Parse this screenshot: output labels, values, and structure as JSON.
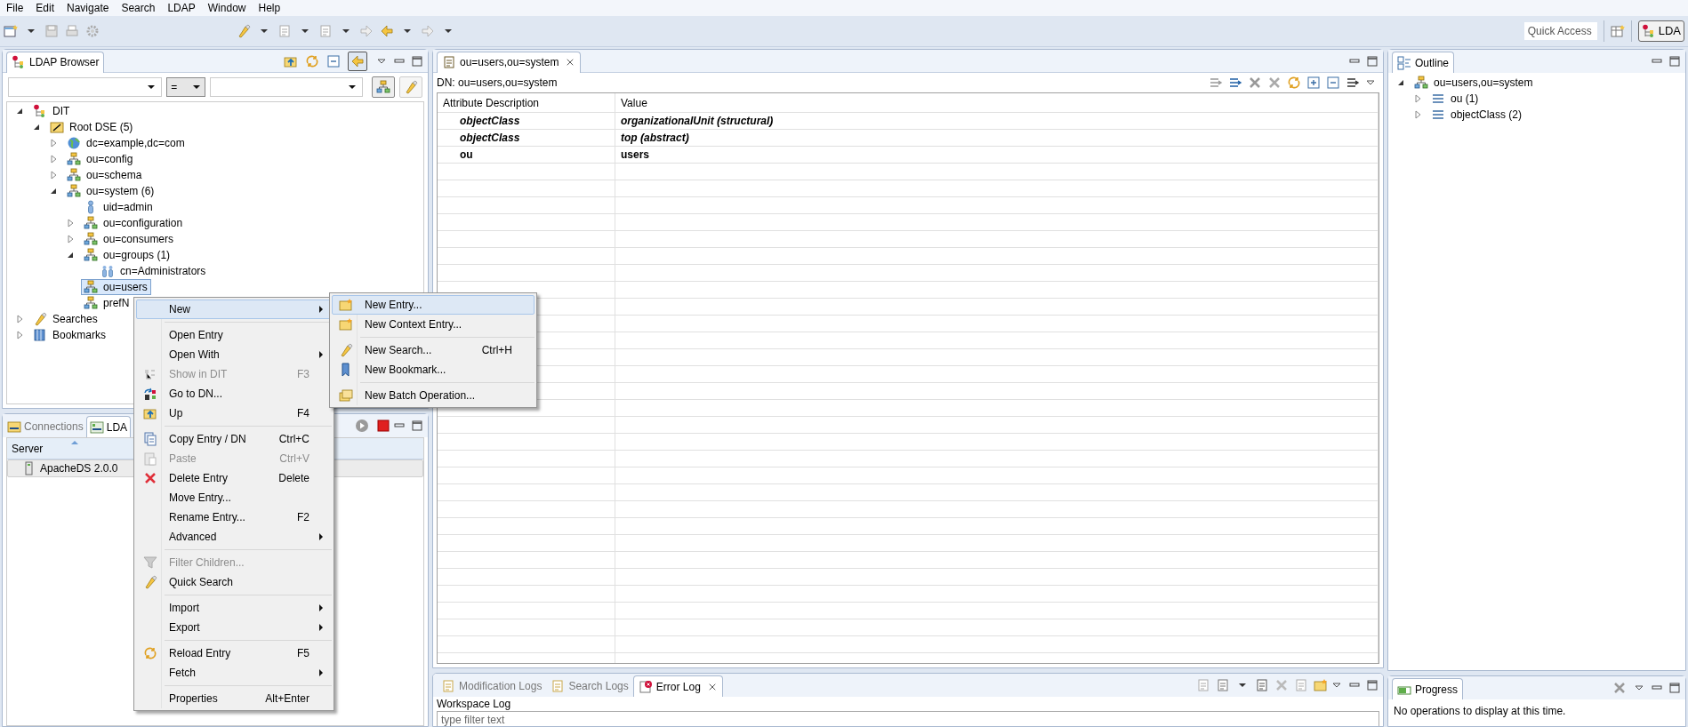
{
  "menubar": [
    "File",
    "Edit",
    "Navigate",
    "Search",
    "LDAP",
    "Window",
    "Help"
  ],
  "quick_access": {
    "placeholder": "Quick Access"
  },
  "perspective": {
    "label": "LDA",
    "selected": true
  },
  "ldap_browser": {
    "title": "LDAP Browser",
    "operator": "=",
    "tree": [
      {
        "label": "DIT",
        "kind": "dit",
        "expanded": true,
        "selected": false,
        "children": [
          {
            "label": "Root DSE (5)",
            "kind": "root",
            "expanded": true,
            "selected": false,
            "children": [
              {
                "label": "dc=example,dc=com",
                "kind": "domain",
                "expanded": false,
                "selected": false
              },
              {
                "label": "ou=config",
                "kind": "ou",
                "expanded": false,
                "selected": false
              },
              {
                "label": "ou=schema",
                "kind": "ou",
                "expanded": false,
                "selected": false
              },
              {
                "label": "ou=system (6)",
                "kind": "ou",
                "expanded": true,
                "selected": false,
                "children": [
                  {
                    "label": "uid=admin",
                    "kind": "person",
                    "selected": false
                  },
                  {
                    "label": "ou=configuration",
                    "kind": "ou",
                    "expanded": false,
                    "selected": false
                  },
                  {
                    "label": "ou=consumers",
                    "kind": "ou",
                    "expanded": false,
                    "selected": false
                  },
                  {
                    "label": "ou=groups (1)",
                    "kind": "ou",
                    "expanded": true,
                    "selected": false,
                    "children": [
                      {
                        "label": "cn=Administrators",
                        "kind": "group",
                        "selected": false
                      }
                    ]
                  },
                  {
                    "label": "ou=users",
                    "kind": "ou",
                    "selected": true
                  },
                  {
                    "label": "prefN",
                    "kind": "ou",
                    "selected": false
                  }
                ]
              }
            ]
          }
        ]
      },
      {
        "label": "Searches",
        "kind": "search",
        "expanded": false,
        "selected": false
      },
      {
        "label": "Bookmarks",
        "kind": "bookmark",
        "expanded": false,
        "selected": false
      }
    ]
  },
  "servers_panel": {
    "tabs": [
      {
        "label": "Connections",
        "selected": false
      },
      {
        "label": "LDA",
        "selected": true
      }
    ],
    "columns": [
      "Server"
    ],
    "rows": [
      "ApacheDS 2.0.0"
    ]
  },
  "editor": {
    "tab": "ou=users,ou=system",
    "dn": "DN: ou=users,ou=system",
    "columns": [
      "Attribute Description",
      "Value"
    ],
    "rows": [
      {
        "attribute": "objectClass",
        "value": "organizationalUnit (structural)",
        "kind": "objectclass"
      },
      {
        "attribute": "objectClass",
        "value": "top (abstract)",
        "kind": "objectclass"
      },
      {
        "attribute": "ou",
        "value": "users",
        "kind": "must"
      }
    ]
  },
  "outline": {
    "title": "Outline",
    "tree": [
      {
        "label": "ou=users,ou=system",
        "kind": "ou",
        "expanded": true,
        "children": [
          {
            "label": "ou (1)",
            "kind": "attr",
            "expanded": false
          },
          {
            "label": "objectClass (2)",
            "kind": "attr",
            "expanded": false
          }
        ]
      }
    ]
  },
  "logs": {
    "tabs": [
      {
        "label": "Modification Logs",
        "selected": false
      },
      {
        "label": "Search Logs",
        "selected": false
      },
      {
        "label": "Error Log",
        "selected": true
      }
    ],
    "heading": "Workspace Log",
    "filter": {
      "placeholder": "type filter text"
    }
  },
  "progress": {
    "title": "Progress",
    "message": "No operations to display at this time."
  },
  "context_menu": [
    {
      "kind": "item",
      "label": "New",
      "submenu": true,
      "selected": true
    },
    {
      "kind": "separator"
    },
    {
      "kind": "item",
      "label": "Open Entry",
      "selected": false
    },
    {
      "kind": "item",
      "label": "Open With",
      "submenu": true,
      "selected": false
    },
    {
      "kind": "item",
      "label": "Show in DIT",
      "shortcut": "F3",
      "disabled": true,
      "selected": false
    },
    {
      "kind": "item",
      "label": "Go to DN...",
      "selected": false
    },
    {
      "kind": "item",
      "label": "Up",
      "shortcut": "F4",
      "selected": false
    },
    {
      "kind": "separator"
    },
    {
      "kind": "item",
      "label": "Copy Entry / DN",
      "shortcut": "Ctrl+C",
      "selected": false
    },
    {
      "kind": "item",
      "label": "Paste",
      "shortcut": "Ctrl+V",
      "disabled": true,
      "selected": false
    },
    {
      "kind": "item",
      "label": "Delete Entry",
      "shortcut": "Delete",
      "selected": false
    },
    {
      "kind": "item",
      "label": "Move Entry...",
      "selected": false
    },
    {
      "kind": "item",
      "label": "Rename Entry...",
      "shortcut": "F2",
      "selected": false
    },
    {
      "kind": "item",
      "label": "Advanced",
      "submenu": true,
      "selected": false
    },
    {
      "kind": "separator"
    },
    {
      "kind": "item",
      "label": "Filter Children...",
      "disabled": true,
      "selected": false
    },
    {
      "kind": "item",
      "label": "Quick Search",
      "selected": false
    },
    {
      "kind": "separator"
    },
    {
      "kind": "item",
      "label": "Import",
      "submenu": true,
      "selected": false
    },
    {
      "kind": "item",
      "label": "Export",
      "submenu": true,
      "selected": false
    },
    {
      "kind": "separator"
    },
    {
      "kind": "item",
      "label": "Reload Entry",
      "shortcut": "F5",
      "selected": false
    },
    {
      "kind": "item",
      "label": "Fetch",
      "submenu": true,
      "selected": false
    },
    {
      "kind": "separator"
    },
    {
      "kind": "item",
      "label": "Properties",
      "shortcut": "Alt+Enter",
      "selected": false
    }
  ],
  "submenu": [
    {
      "kind": "item",
      "label": "New Entry...",
      "selected": true
    },
    {
      "kind": "item",
      "label": "New Context Entry...",
      "selected": false
    },
    {
      "kind": "separator"
    },
    {
      "kind": "item",
      "label": "New Search...",
      "shortcut": "Ctrl+H",
      "selected": false
    },
    {
      "kind": "item",
      "label": "New Bookmark...",
      "selected": false
    },
    {
      "kind": "separator"
    },
    {
      "kind": "item",
      "label": "New Batch Operation...",
      "selected": false
    }
  ]
}
